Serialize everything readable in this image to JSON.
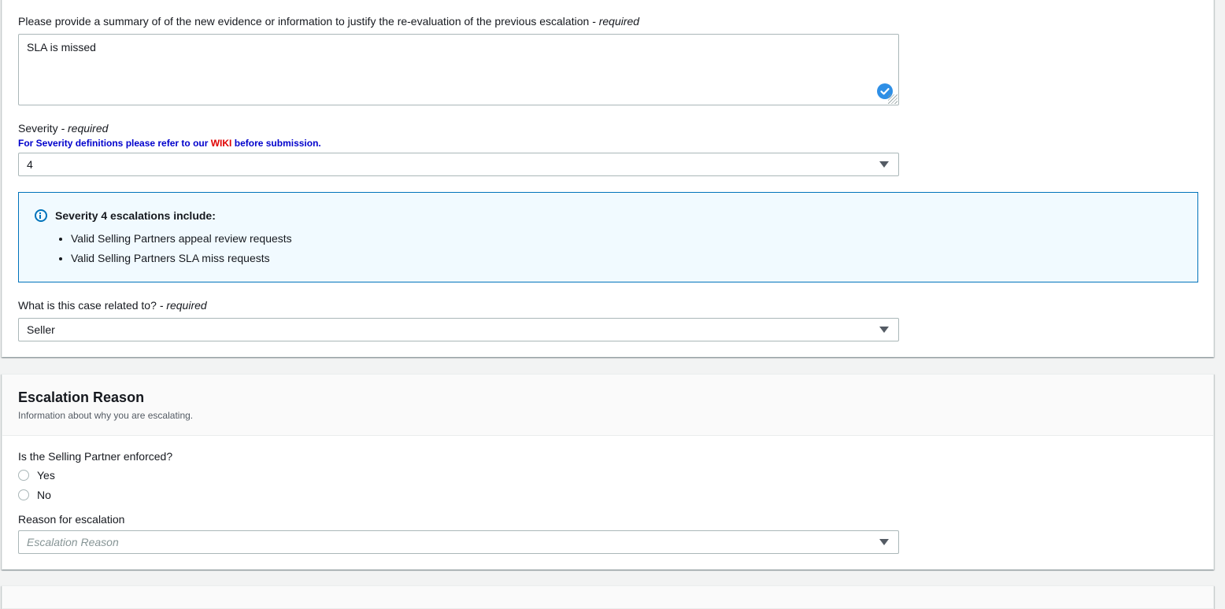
{
  "evidence": {
    "label": "Please provide a summary of of the new evidence or information to justify the re-evaluation of the previous escalation",
    "required": "- required",
    "value": "SLA is missed"
  },
  "severity": {
    "label": "Severity",
    "required": "- required",
    "hint_prefix": "For Severity definitions please refer to our ",
    "hint_link": "WIKI",
    "hint_suffix": " before submission.",
    "value": "4"
  },
  "info": {
    "title": "Severity 4 escalations include:",
    "items": [
      "Valid Selling Partners appeal review requests",
      "Valid Selling Partners SLA miss requests"
    ]
  },
  "case_related": {
    "label": "What is this case related to?",
    "required": "- required",
    "value": "Seller"
  },
  "escalation": {
    "title": "Escalation Reason",
    "subtitle": "Information about why you are escalating.",
    "enforced_label": "Is the Selling Partner enforced?",
    "options": [
      "Yes",
      "No"
    ],
    "reason_label": "Reason for escalation",
    "reason_placeholder": "Escalation Reason"
  },
  "colors": {
    "info_border": "#0073bb",
    "info_bg": "#f1faff",
    "hint_text": "#0000cc",
    "wiki_link": "#e00000"
  }
}
